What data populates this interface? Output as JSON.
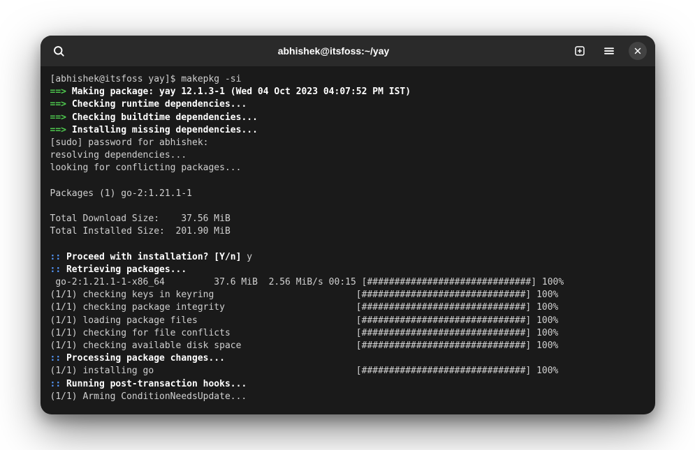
{
  "title": "abhishek@itsfoss:~/yay",
  "prompt": {
    "user_host": "[abhishek@itsfoss yay]$ ",
    "command": "makepkg -si"
  },
  "making_pkg": {
    "arrow": "==> ",
    "label": "Making package: ",
    "pkg": "yay 12.1.3-1 (Wed 04 Oct 2023 04:07:52 PM IST)"
  },
  "checking_runtime": {
    "arrow": "==> ",
    "label": "Checking runtime dependencies..."
  },
  "checking_buildtime": {
    "arrow": "==> ",
    "label": "Checking buildtime dependencies..."
  },
  "installing_missing": {
    "arrow": "==> ",
    "label": "Installing missing dependencies..."
  },
  "sudo_prompt": "[sudo] password for abhishek: ",
  "resolving": "resolving dependencies...",
  "conflicting": "looking for conflicting packages...",
  "packages_line": "Packages (1) go-2:1.21.1-1",
  "download_size": "Total Download Size:    37.56 MiB",
  "installed_size": "Total Installed Size:  201.90 MiB",
  "proceed": ":: Proceed with installation? [Y/n] y",
  "retrieving": ":: Retrieving packages...",
  "download_line": " go-2:1.21.1-1-x86_64         37.6 MiB  2.56 MiB/s 00:15 [##############################] 100%",
  "check_keys": "(1/1) checking keys in keyring                          [##############################] 100%",
  "check_integrity": "(1/1) checking package integrity                        [##############################] 100%",
  "loading_files": "(1/1) loading package files                             [##############################] 100%",
  "check_conflicts": "(1/1) checking for file conflicts                       [##############################] 100%",
  "check_disk": "(1/1) checking available disk space                     [##############################] 100%",
  "processing": ":: Processing package changes...",
  "installing_go": "(1/1) installing go                                     [##############################] 100%",
  "post_hooks": ":: Running post-transaction hooks...",
  "arming": "(1/1) Arming ConditionNeedsUpdate..."
}
